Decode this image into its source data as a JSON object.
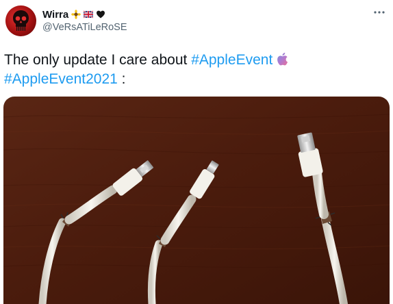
{
  "tweet": {
    "author": {
      "display_name": "Wirra",
      "handle": "@VeRsATiLeRoSE",
      "name_emojis": [
        "sunflower-emoji",
        "uk-flag-emoji",
        "heart-emoji"
      ]
    },
    "text_intro": "The only update I care about ",
    "hashtags": [
      "#AppleEvent",
      "#AppleEvent2021"
    ],
    "text_tail": " :",
    "post_emoji": "apple-logo-emoji",
    "image": {
      "subject": "frayed-lightning-cables-photo"
    }
  },
  "colors": {
    "hashtag": "#1d9bf0",
    "handle": "#536471",
    "avatar": "#c41e1e",
    "wood": "#4a1a0c"
  }
}
